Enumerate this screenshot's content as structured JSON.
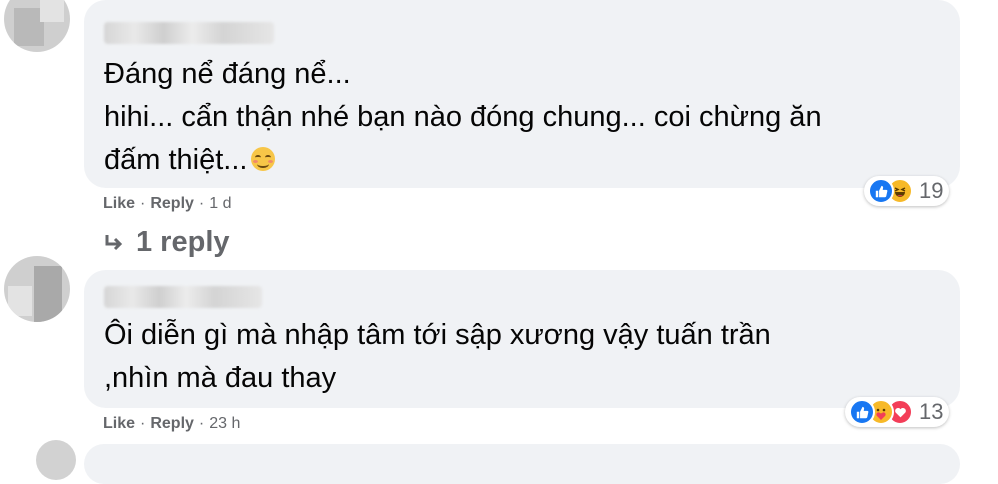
{
  "comments": [
    {
      "text_lines": [
        "Đáng nể đáng nể...",
        "hihi... cẩn thận nhé bạn nào đóng chung... coi chừng ăn",
        "đấm thiệt..."
      ],
      "emoji": "smiling-face-emoji",
      "reactions": {
        "icons": [
          "like-icon",
          "haha-icon"
        ],
        "count": "19"
      },
      "actions": {
        "like": "Like",
        "reply": "Reply",
        "time": "1 d"
      },
      "replies_label": "1 reply"
    },
    {
      "text_lines": [
        "Ôi diễn gì mà nhập tâm tới sập xương vậy tuấn trần",
        ",nhìn mà đau thay"
      ],
      "reactions": {
        "icons": [
          "like-icon",
          "care-icon",
          "love-icon"
        ],
        "count": "13"
      },
      "actions": {
        "like": "Like",
        "reply": "Reply",
        "time": "23 h"
      }
    }
  ],
  "colors": {
    "bubble_bg": "#f0f2f5",
    "meta_text": "#65676b",
    "like_blue": "#1877f2",
    "love_red": "#f33e58",
    "haha_yellow": "#f7b928"
  }
}
